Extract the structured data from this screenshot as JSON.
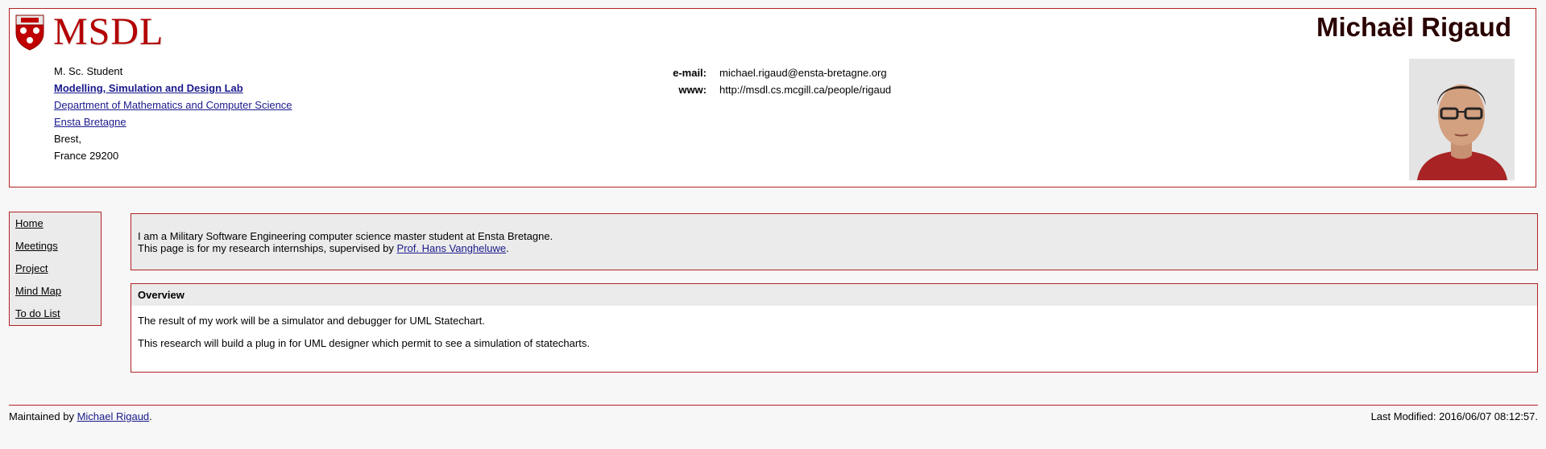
{
  "header": {
    "logo_text": "MSDL",
    "person_name": "Michaël Rigaud",
    "address": {
      "title": "M. Sc. Student",
      "lab_link": "Modelling, Simulation and Design Lab",
      "dept_link": "Department of Mathematics and Computer Science",
      "school_link": "Ensta Bretagne",
      "city": "Brest,",
      "country": "France 29200"
    },
    "contact": {
      "email_label": "e-mail:",
      "email_value": "michael.rigaud@ensta-bretagne.org",
      "www_label": "www:",
      "www_value": "http://msdl.cs.mcgill.ca/people/rigaud"
    }
  },
  "nav": {
    "items": [
      {
        "label": "Home"
      },
      {
        "label": "Meetings"
      },
      {
        "label": "Project"
      },
      {
        "label": "Mind Map"
      },
      {
        "label": "To do List"
      }
    ]
  },
  "intro": {
    "line1": "I am a Military Software Engineering computer science master student at Ensta Bretagne.",
    "line2_prefix": "This page is for my research internships, supervised by ",
    "supervisor_link": "Prof. Hans Vangheluwe",
    "line2_suffix": "."
  },
  "overview": {
    "title": "Overview",
    "para1": "The result of my work will be a simulator and debugger for UML Statechart.",
    "para2": "This research will build a plug in for UML designer which permit to see a simulation of statecharts."
  },
  "footer": {
    "maintained_prefix": "Maintained by ",
    "maintainer_link": "Michael Rigaud",
    "maintained_suffix": ".",
    "last_modified": "Last Modified: 2016/06/07 08:12:57."
  },
  "colors": {
    "border": "#b22222",
    "logo": "#b40000",
    "link": "#1a1a8c"
  },
  "icons": {
    "logo_shield": "mcgill-shield-icon",
    "photo": "profile-photo"
  }
}
